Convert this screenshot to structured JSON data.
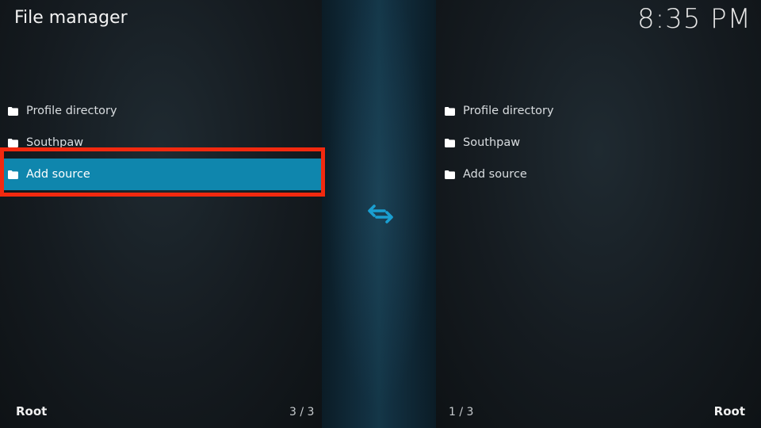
{
  "header": {
    "title": "File manager",
    "clock": "8:35 PM"
  },
  "left_pane": {
    "items": [
      {
        "label": "Profile directory",
        "icon": "folder-icon"
      },
      {
        "label": "Southpaw",
        "icon": "folder-icon"
      },
      {
        "label": "Add source",
        "icon": "folder-icon",
        "selected": true
      }
    ],
    "footer_label": "Root",
    "footer_count": "3 / 3"
  },
  "right_pane": {
    "items": [
      {
        "label": "Profile directory",
        "icon": "folder-icon"
      },
      {
        "label": "Southpaw",
        "icon": "folder-icon"
      },
      {
        "label": "Add source",
        "icon": "folder-icon"
      }
    ],
    "footer_label": "Root",
    "footer_count": "1 / 3"
  },
  "center": {
    "icon": "swap-arrows-icon"
  },
  "colors": {
    "selection": "#0f86ad",
    "annotation_box": "#f2290f",
    "accent_icon": "#1a9fd1"
  }
}
